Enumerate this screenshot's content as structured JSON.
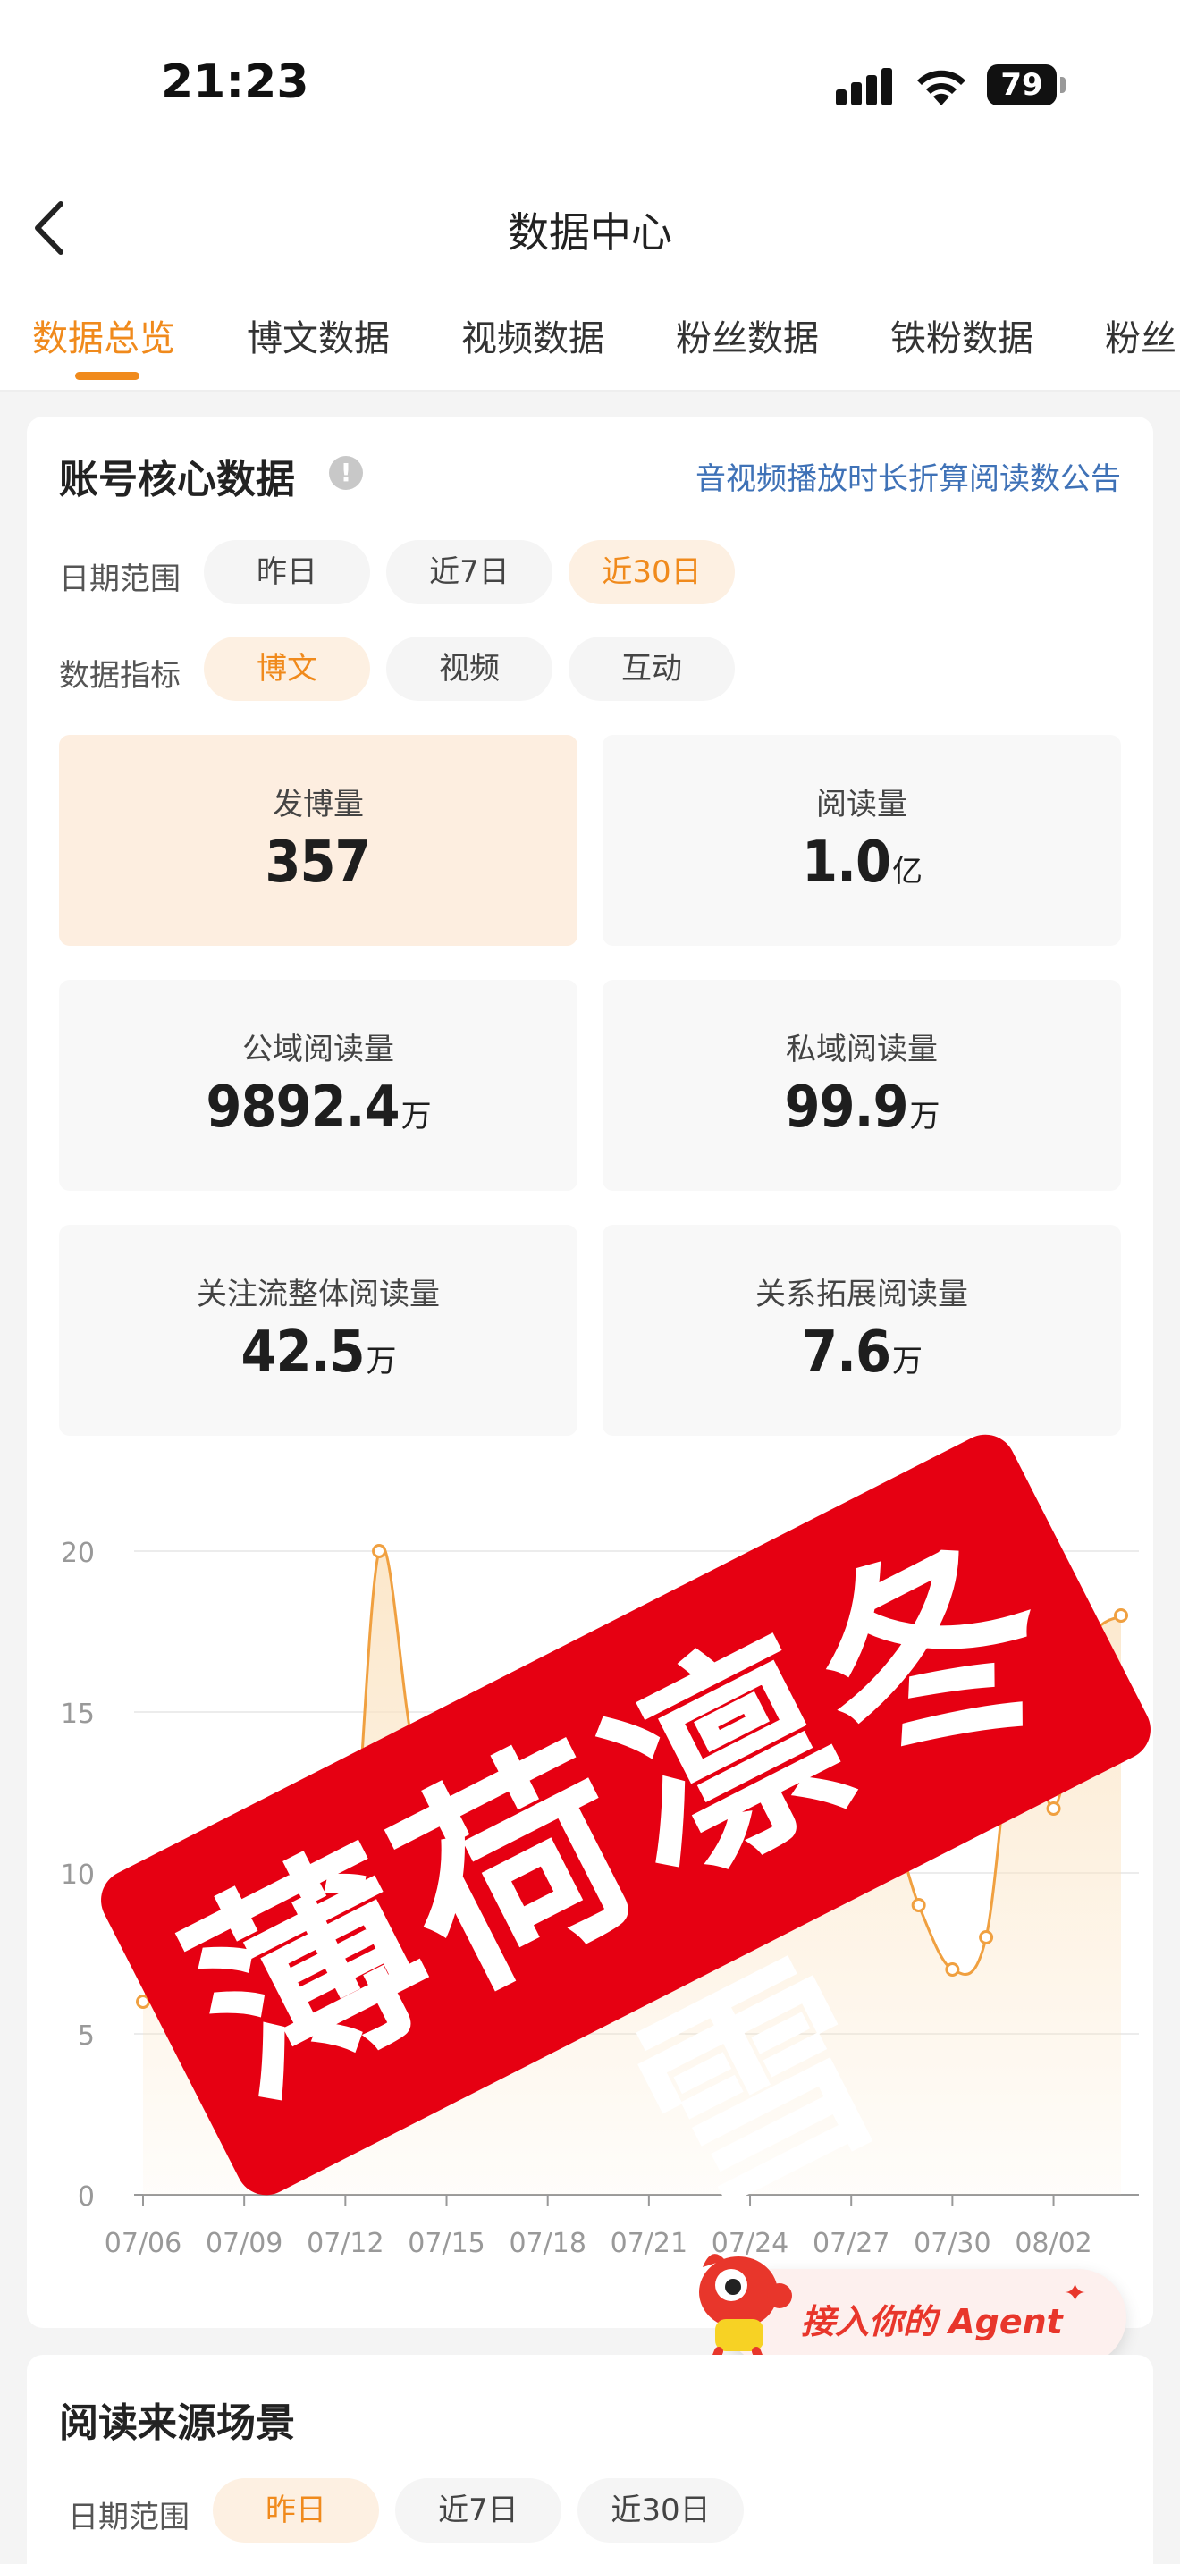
{
  "status_bar": {
    "time": "21:23",
    "battery": "79"
  },
  "header": {
    "title": "数据中心"
  },
  "tabs": [
    "数据总览",
    "博文数据",
    "视频数据",
    "粉丝数据",
    "铁粉数据",
    "粉丝"
  ],
  "core": {
    "title": "账号核心数据",
    "info_icon": "!",
    "notice_link": "音视频播放时长折算阅读数公告",
    "date_label": "日期范围",
    "date_options": [
      "昨日",
      "近7日",
      "近30日"
    ],
    "date_selected": "近30日",
    "metric_label": "数据指标",
    "metric_options": [
      "博文",
      "视频",
      "互动"
    ],
    "metric_selected": "博文",
    "stats": [
      {
        "label": "发博量",
        "value": "357",
        "unit": ""
      },
      {
        "label": "阅读量",
        "value": "1.0",
        "unit": "亿"
      },
      {
        "label": "公域阅读量",
        "value": "9892.4",
        "unit": "万"
      },
      {
        "label": "私域阅读量",
        "value": "99.9",
        "unit": "万"
      },
      {
        "label": "关注流整体阅读量",
        "value": "42.5",
        "unit": "万"
      },
      {
        "label": "关系拓展阅读量",
        "value": "7.6",
        "unit": "万"
      }
    ]
  },
  "chart_data": {
    "type": "area",
    "x": [
      "07/06",
      "07/07",
      "07/08",
      "07/09",
      "07/10",
      "07/11",
      "07/12",
      "07/13",
      "07/14",
      "07/15",
      "07/16",
      "07/17",
      "07/18",
      "07/19",
      "07/20",
      "07/21",
      "07/22",
      "07/23",
      "07/24",
      "07/25",
      "07/26",
      "07/27",
      "07/28",
      "07/29",
      "07/30",
      "07/31",
      "08/01",
      "08/02",
      "08/03",
      "08/04"
    ],
    "y": [
      6,
      8,
      7,
      6,
      7,
      9,
      7,
      20,
      14,
      12,
      10,
      9,
      7,
      15,
      13,
      12,
      12,
      13,
      8,
      12,
      9,
      11,
      12,
      9,
      7,
      8,
      16,
      12,
      17,
      18
    ],
    "tick_labels": [
      "07/06",
      "07/09",
      "07/12",
      "07/15",
      "07/18",
      "07/21",
      "07/24",
      "07/27",
      "07/30",
      "08/02"
    ],
    "ylim": [
      0,
      20
    ],
    "yticks": [
      0,
      5,
      10,
      15,
      20
    ],
    "grid": true,
    "colors": {
      "line": "#f0a040",
      "fill": "#fbe3c1"
    }
  },
  "watermark": {
    "text": "薄荷凛冬雪",
    "color": "#e60012"
  },
  "agent_button": {
    "label": "接入你的 Agent",
    "spark": "✦"
  },
  "sources": {
    "title": "阅读来源场景",
    "date_label": "日期范围",
    "date_options": [
      "昨日",
      "近7日",
      "近30日"
    ],
    "date_selected": "昨日"
  },
  "colors": {
    "accent": "#f08a1c",
    "link": "#3f72b7"
  }
}
